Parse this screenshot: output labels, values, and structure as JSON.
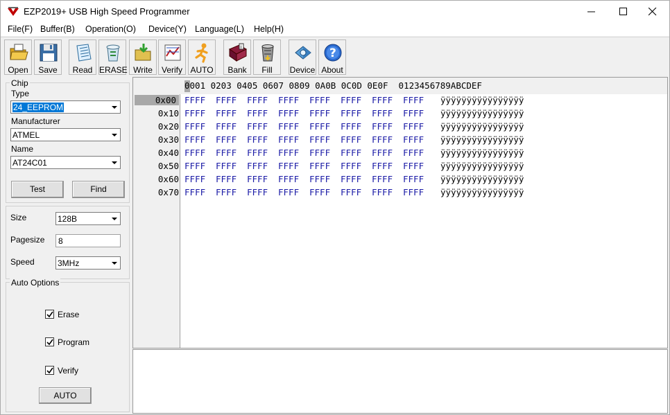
{
  "window": {
    "title": "EZP2019+ USB High Speed Programmer"
  },
  "menu": [
    "File(F)",
    "Buffer(B)",
    "Operation(O)",
    "Device(Y)",
    "Language(L)",
    "Help(H)"
  ],
  "toolbar": [
    {
      "label": "Open",
      "icon": "open-folder-icon"
    },
    {
      "label": "Save",
      "icon": "floppy-disk-icon"
    },
    {
      "label": "Read",
      "icon": "read-document-icon"
    },
    {
      "label": "ERASE",
      "icon": "recycle-bin-icon"
    },
    {
      "label": "Write",
      "icon": "write-folder-icon"
    },
    {
      "label": "Verify",
      "icon": "verify-chart-icon"
    },
    {
      "label": "AUTO",
      "icon": "running-man-icon"
    },
    {
      "label": "Bank",
      "icon": "bank-book-icon"
    },
    {
      "label": "Fill",
      "icon": "fill-bucket-icon"
    },
    {
      "label": "Device",
      "icon": "device-chip-icon"
    },
    {
      "label": "About",
      "icon": "help-question-icon"
    }
  ],
  "chip": {
    "group_title": "Chip",
    "type_label": "Type",
    "type_value": "24_EEPROM",
    "manufacturer_label": "Manufacturer",
    "manufacturer_value": "ATMEL",
    "name_label": "Name",
    "name_value": "AT24C01",
    "test_button": "Test",
    "find_button": "Find"
  },
  "settings": {
    "size_label": "Size",
    "size_value": "128B",
    "pagesize_label": "Pagesize",
    "pagesize_value": "8",
    "speed_label": "Speed",
    "speed_value": "3MHz"
  },
  "auto_options": {
    "group_title": "Auto Options",
    "erase_label": "Erase",
    "erase_checked": true,
    "program_label": "Program",
    "program_checked": true,
    "verify_label": "Verify",
    "verify_checked": true,
    "auto_button": "AUTO"
  },
  "hex": {
    "header": "0001 0203 0405 0607 0809 0A0B 0C0D 0E0F  0123456789ABCDEF",
    "rows": [
      {
        "addr": "0x00",
        "words": [
          "FFFF",
          "FFFF",
          "FFFF",
          "FFFF",
          "FFFF",
          "FFFF",
          "FFFF",
          "FFFF"
        ],
        "ascii": "ÿÿÿÿÿÿÿÿÿÿÿÿÿÿÿÿ"
      },
      {
        "addr": "0x10",
        "words": [
          "FFFF",
          "FFFF",
          "FFFF",
          "FFFF",
          "FFFF",
          "FFFF",
          "FFFF",
          "FFFF"
        ],
        "ascii": "ÿÿÿÿÿÿÿÿÿÿÿÿÿÿÿÿ"
      },
      {
        "addr": "0x20",
        "words": [
          "FFFF",
          "FFFF",
          "FFFF",
          "FFFF",
          "FFFF",
          "FFFF",
          "FFFF",
          "FFFF"
        ],
        "ascii": "ÿÿÿÿÿÿÿÿÿÿÿÿÿÿÿÿ"
      },
      {
        "addr": "0x30",
        "words": [
          "FFFF",
          "FFFF",
          "FFFF",
          "FFFF",
          "FFFF",
          "FFFF",
          "FFFF",
          "FFFF"
        ],
        "ascii": "ÿÿÿÿÿÿÿÿÿÿÿÿÿÿÿÿ"
      },
      {
        "addr": "0x40",
        "words": [
          "FFFF",
          "FFFF",
          "FFFF",
          "FFFF",
          "FFFF",
          "FFFF",
          "FFFF",
          "FFFF"
        ],
        "ascii": "ÿÿÿÿÿÿÿÿÿÿÿÿÿÿÿÿ"
      },
      {
        "addr": "0x50",
        "words": [
          "FFFF",
          "FFFF",
          "FFFF",
          "FFFF",
          "FFFF",
          "FFFF",
          "FFFF",
          "FFFF"
        ],
        "ascii": "ÿÿÿÿÿÿÿÿÿÿÿÿÿÿÿÿ"
      },
      {
        "addr": "0x60",
        "words": [
          "FFFF",
          "FFFF",
          "FFFF",
          "FFFF",
          "FFFF",
          "FFFF",
          "FFFF",
          "FFFF"
        ],
        "ascii": "ÿÿÿÿÿÿÿÿÿÿÿÿÿÿÿÿ"
      },
      {
        "addr": "0x70",
        "words": [
          "FFFF",
          "FFFF",
          "FFFF",
          "FFFF",
          "FFFF",
          "FFFF",
          "FFFF",
          "FFFF"
        ],
        "ascii": "ÿÿÿÿÿÿÿÿÿÿÿÿÿÿÿÿ"
      }
    ]
  },
  "colors": {
    "hex_value": "#1a1aa6",
    "selection": "#0078d7",
    "cursor": "#a8a8a8"
  }
}
